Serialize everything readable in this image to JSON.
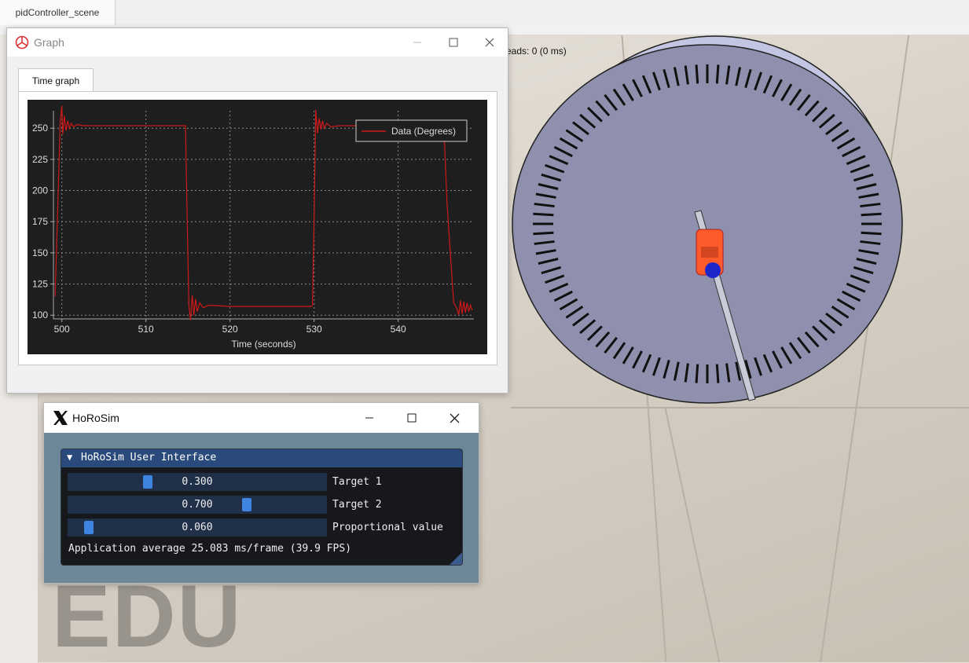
{
  "scene": {
    "tab_label": "pidController_scene",
    "threads_text": "eads: 0 (0 ms)",
    "watermark": "EDU"
  },
  "graph_window": {
    "title": "Graph",
    "tab_label": "Time graph",
    "controls": {
      "minimize": "minimize-icon",
      "maximize": "maximize-icon",
      "close": "close-icon"
    }
  },
  "horosim_window": {
    "title": "HoRoSim",
    "panel_header": "HoRoSim User Interface",
    "sliders": [
      {
        "value_text": "0.300",
        "label": "Target 1",
        "fraction": 0.3
      },
      {
        "value_text": "0.700",
        "label": "Target 2",
        "fraction": 0.7
      },
      {
        "value_text": "0.060",
        "label": "Proportional value",
        "fraction": 0.06
      }
    ],
    "fps_text": "Application average 25.083 ms/frame (39.9 FPS)"
  },
  "chart_data": {
    "type": "line",
    "title": "",
    "xlabel": "Time (seconds)",
    "ylabel": "",
    "xlim": [
      499,
      549
    ],
    "ylim": [
      97,
      264
    ],
    "x_ticks": [
      500,
      510,
      520,
      530,
      540
    ],
    "y_ticks": [
      100,
      125,
      150,
      175,
      200,
      225,
      250
    ],
    "grid": true,
    "legend_position": "top-right",
    "colors": {
      "background": "#1e1e1e",
      "series": "#d01818",
      "text": "#dddddd",
      "grid": "#8a8a8a"
    },
    "series": [
      {
        "name": "Data (Degrees)",
        "x": [
          499.2,
          499.5,
          499.8,
          500.0,
          500.1,
          500.3,
          500.5,
          500.7,
          500.9,
          501.1,
          501.4,
          501.8,
          502.5,
          505,
          510,
          514.7,
          514.9,
          515.1,
          515.3,
          515.5,
          515.7,
          515.9,
          516.1,
          516.4,
          516.8,
          517.5,
          520,
          525,
          529.6,
          529.8,
          530.0,
          530.2,
          530.4,
          530.6,
          530.8,
          531.0,
          531.2,
          531.5,
          532,
          533,
          535,
          540,
          545.2,
          545.5,
          545.8,
          546.2,
          546.6,
          547.0,
          547.2,
          547.4,
          547.6,
          547.8,
          548.0,
          548.2,
          548.4,
          548.6,
          548.8
        ],
        "y": [
          115,
          185,
          255,
          268,
          245,
          260,
          248,
          256,
          250,
          254,
          251,
          253,
          252,
          252,
          252,
          252,
          180,
          108,
          96,
          116,
          100,
          113,
          103,
          110,
          106,
          108,
          107,
          107,
          107,
          108,
          178,
          265,
          246,
          258,
          249,
          256,
          250,
          254,
          251,
          252,
          252,
          252,
          252,
          240,
          190,
          150,
          110,
          105,
          100,
          112,
          101,
          111,
          102,
          110,
          103,
          108,
          104
        ]
      }
    ]
  }
}
